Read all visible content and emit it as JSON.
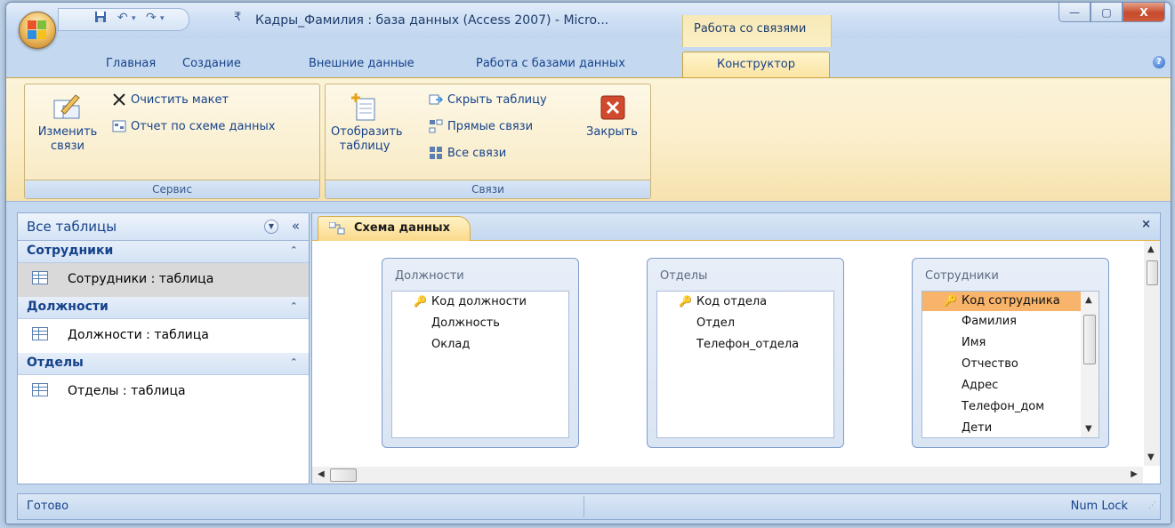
{
  "window": {
    "title": "Кадры_Фамилия : база данных (Access 2007) - Micro...",
    "context_tab_title": "Работа со связями",
    "minimize_label": "—",
    "maximize_label": "▢",
    "close_label": "X"
  },
  "tabs": [
    {
      "label": "Главная"
    },
    {
      "label": "Создание"
    },
    {
      "label": "Внешние данные"
    },
    {
      "label": "Работа с базами данных"
    },
    {
      "label": "Конструктор"
    }
  ],
  "ribbon": {
    "service": {
      "label": "Сервис",
      "edit_links": "Изменить связи",
      "clear_layout": "Очистить макет",
      "report": "Отчет по схеме данных"
    },
    "links": {
      "label": "Связи",
      "show_table": "Отобразить таблицу",
      "hide_table": "Скрыть таблицу",
      "direct_links": "Прямые связи",
      "all_links": "Все связи",
      "close": "Закрыть"
    }
  },
  "nav": {
    "title": "Все таблицы",
    "groups": [
      {
        "name": "Сотрудники",
        "item": "Сотрудники : таблица"
      },
      {
        "name": "Должности",
        "item": "Должности : таблица"
      },
      {
        "name": "Отделы",
        "item": "Отделы : таблица"
      }
    ]
  },
  "document": {
    "tab_title": "Схема данных",
    "close_label": "×",
    "tables": [
      {
        "name": "Должности",
        "fields": [
          "Код должности",
          "Должность",
          "Оклад"
        ]
      },
      {
        "name": "Отделы",
        "fields": [
          "Код отдела",
          "Отдел",
          "Телефон_отдела"
        ]
      },
      {
        "name": "Сотрудники",
        "fields": [
          "Код сотрудника",
          "Фамилия",
          "Имя",
          "Отчество",
          "Адрес",
          "Телефон_дом",
          "Дети"
        ]
      }
    ]
  },
  "status": {
    "left": "Готово",
    "right": "Num Lock"
  },
  "colors": {
    "accent_orange": "#f7b46a",
    "ribbon_bg": "#fcefcd",
    "frame_blue": "#c4d8ef",
    "close_red": "#c64a2b"
  }
}
